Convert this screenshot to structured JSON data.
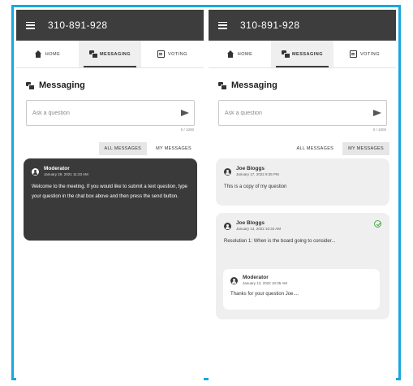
{
  "app": {
    "phone_number": "310-891-928",
    "tabs": [
      {
        "label": "HOME",
        "icon": "home-icon"
      },
      {
        "label": "MESSAGING",
        "icon": "messaging-icon"
      },
      {
        "label": "VOTING",
        "icon": "voting-icon"
      }
    ],
    "section_title": "Messaging",
    "ask_placeholder": "Ask a question",
    "char_counter": "0 / 1000",
    "filters": {
      "all": "ALL MESSAGES",
      "mine": "MY MESSAGES"
    }
  },
  "left_panel": {
    "active_filter": "all",
    "messages": [
      {
        "author": "Moderator",
        "date": "January 29, 2021 11:23 AM",
        "text": "Welcome to the meeting. If you would like to submit a text question, type your question in the chat box above and then press the send button."
      }
    ]
  },
  "right_panel": {
    "active_filter": "mine",
    "messages": [
      {
        "author": "Joe Bloggs",
        "date": "January 17, 2022 8:35 PM",
        "text": "This is a copy of my question"
      },
      {
        "author": "Joe Bloggs",
        "date": "January 13, 2022 10:34 AM",
        "text": "Resolution 1: When is the board going to consider...",
        "answered": true,
        "reply": {
          "author": "Moderator",
          "date": "January 13, 2022 10:35 AM",
          "text": "Thanks for your question Joe...."
        }
      }
    ]
  },
  "colors": {
    "frame_border": "#19a7e0",
    "top_bar": "#3d3d3d",
    "dark_card": "#3a3a3a",
    "light_card": "#efefef",
    "answered_check": "#4aa84a"
  }
}
